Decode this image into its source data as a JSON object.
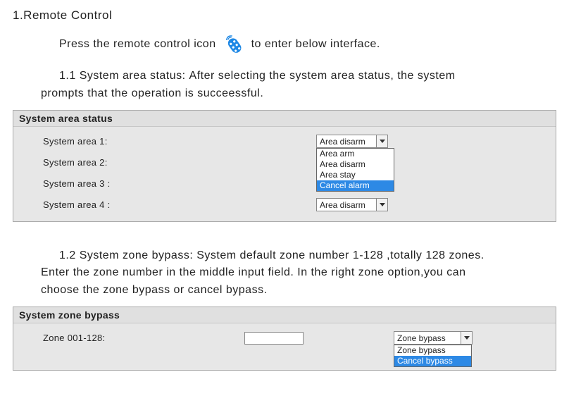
{
  "heading": "1.Remote Control",
  "intro": {
    "before": "Press the remote control icon",
    "after": "to enter below interface."
  },
  "section1": {
    "title_prefix": "1.1 System area status: ",
    "title_rest_line1": "After selecting the system area status, the system",
    "title_rest_line2": "prompts that the operation is succeessful.",
    "panel_header": "System area status",
    "rows": [
      {
        "label": "System area 1:",
        "value": "Area disarm"
      },
      {
        "label": "System area 2:",
        "value": ""
      },
      {
        "label": "System area 3 :",
        "value": ""
      },
      {
        "label": "System area 4 :",
        "value": "Area disarm"
      }
    ],
    "dropdown_options": [
      "Area arm",
      "Area disarm",
      "Area stay",
      "Cancel alarm"
    ],
    "dropdown_highlight_index": 3
  },
  "section2": {
    "title_prefix": "1.2 System zone bypass: ",
    "title_rest_line1": "System default zone number 1-128 ,totally 128 zones.",
    "title_rest_line2": "Enter the zone number in the middle input field. In the right zone option,you can",
    "title_rest_line3": "choose the zone bypass or cancel bypass.",
    "panel_header": "System zone bypass",
    "row": {
      "label": "Zone 001-128:",
      "input_value": "",
      "select_value": "Zone bypass"
    },
    "dropdown_options": [
      "Zone bypass",
      "Cancel bypass"
    ],
    "dropdown_highlight_index": 1
  }
}
